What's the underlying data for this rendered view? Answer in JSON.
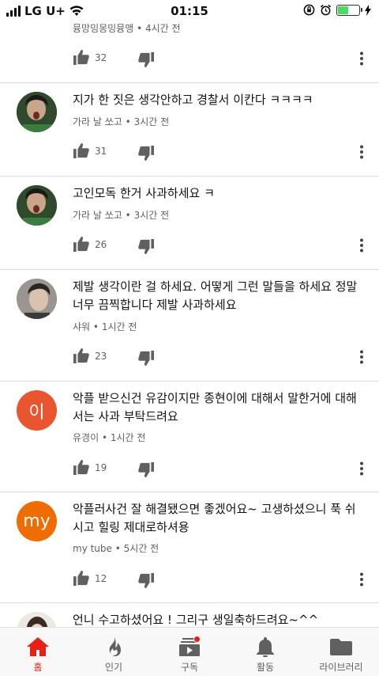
{
  "status_bar": {
    "carrier": "LG U+",
    "time": "01:15",
    "battery_level": 0.5
  },
  "comments": [
    {
      "text": "",
      "author": "뮹망밍몽밍뮹맹",
      "time": "4시간 전",
      "likes": "32",
      "avatar": {
        "kind": "none"
      }
    },
    {
      "text": "지가 한 짓은 생각안하고 경찰서 이칸다 ㅋㅋㅋㅋ",
      "author": "가라 날 쏘고",
      "time": "3시간 전",
      "likes": "31",
      "avatar": {
        "kind": "photo",
        "bg": "#2d3b2a",
        "fg": "#c9a68a"
      }
    },
    {
      "text": "고인모독 한거 사과하세요 ㅋ",
      "author": "가라 날 쏘고",
      "time": "3시간 전",
      "likes": "26",
      "avatar": {
        "kind": "photo",
        "bg": "#2d3b2a",
        "fg": "#c9a68a"
      }
    },
    {
      "text": "제발 생각이란 걸 하세요. 어떻게 그런 말들을 하세요 정말 너무 끔찍합니다 제발 사과하세요",
      "author": "샤워",
      "time": "1시간 전",
      "likes": "23",
      "avatar": {
        "kind": "photo",
        "bg": "#8e8a86",
        "fg": "#d9c3ae"
      }
    },
    {
      "text": "악플 받으신건 유감이지만 종현이에 대해서 말한거에 대해서는 사과 부탁드려요",
      "author": "유경이",
      "time": "1시간 전",
      "likes": "19",
      "avatar": {
        "kind": "letter",
        "letter": "이",
        "color": "#e8552f"
      }
    },
    {
      "text": "악플러사건 잘 해결됐으면 좋겠어요~ 고생하셨으니 푹 쉬시고 힐링 제대로하셔용",
      "author": "my tube",
      "time": "5시간 전",
      "likes": "12",
      "avatar": {
        "kind": "letter",
        "letter": "my",
        "color": "#ef6c00"
      }
    },
    {
      "text": "언니 수고하셨어요 ! 그리구 생일축하드려요~^^",
      "author": "",
      "time": "",
      "likes": "",
      "avatar": {
        "kind": "photo",
        "bg": "#e9e4df",
        "fg": "#3a2a22"
      }
    }
  ],
  "bottom_nav": [
    {
      "label": "홈",
      "icon": "home-icon",
      "active": true
    },
    {
      "label": "인기",
      "icon": "flame-icon",
      "active": false
    },
    {
      "label": "구독",
      "icon": "subscriptions-icon",
      "active": false
    },
    {
      "label": "활동",
      "icon": "bell-icon",
      "active": false
    },
    {
      "label": "라이브러리",
      "icon": "folder-icon",
      "active": false
    }
  ],
  "colors": {
    "accent": "#e62117",
    "meta_text": "#606060",
    "divider": "#dadada"
  }
}
